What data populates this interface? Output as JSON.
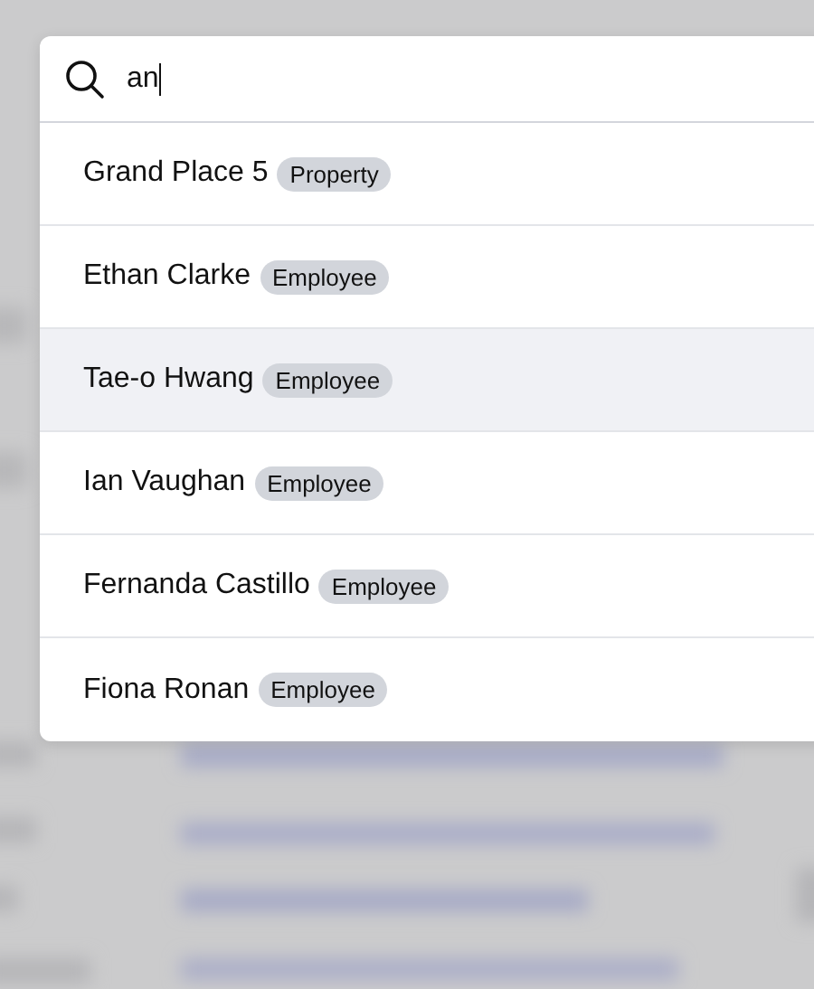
{
  "search": {
    "value": "an"
  },
  "results": [
    {
      "name": "Grand Place 5",
      "tag": "Property",
      "selected": false
    },
    {
      "name": "Ethan Clarke",
      "tag": "Employee",
      "selected": false
    },
    {
      "name": "Tae-o Hwang",
      "tag": "Employee",
      "selected": true
    },
    {
      "name": "Ian Vaughan",
      "tag": "Employee",
      "selected": false
    },
    {
      "name": "Fernanda Castillo",
      "tag": "Employee",
      "selected": false
    },
    {
      "name": "Fiona Ronan",
      "tag": "Employee",
      "selected": false
    }
  ]
}
